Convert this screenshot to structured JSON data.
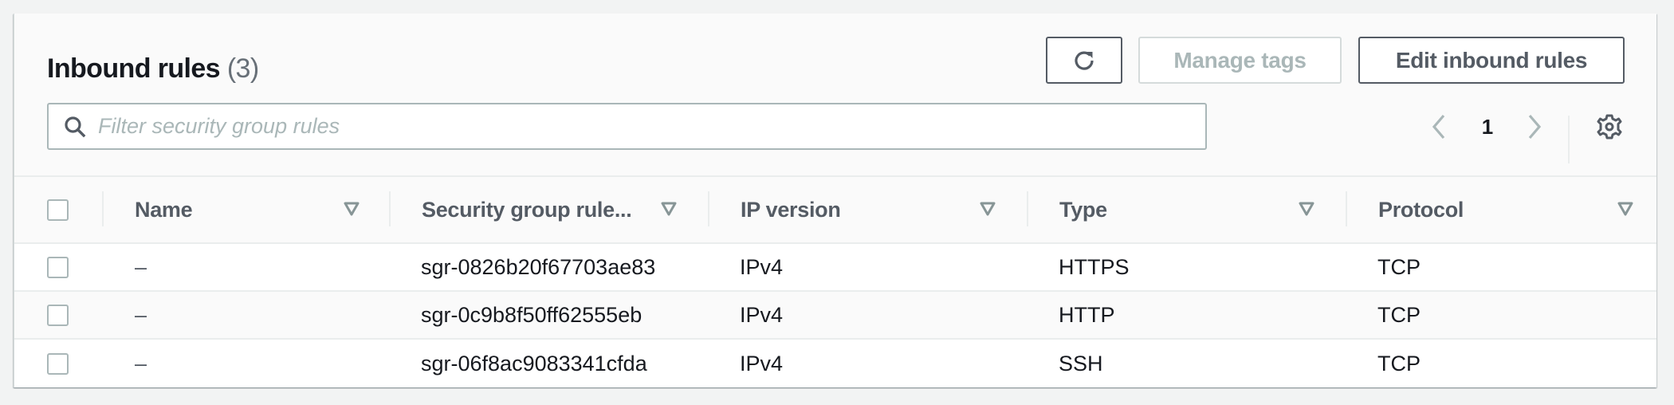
{
  "header": {
    "title": "Inbound rules",
    "count": "(3)"
  },
  "actions": {
    "refresh_icon": "refresh-icon",
    "manage_tags_label": "Manage tags",
    "manage_tags_disabled": true,
    "edit_label": "Edit inbound rules"
  },
  "filter": {
    "placeholder": "Filter security group rules",
    "value": "",
    "icon": "search-icon"
  },
  "pagination": {
    "current_page": "1",
    "prev_icon": "chevron-left-icon",
    "next_icon": "chevron-right-icon",
    "settings_icon": "gear-icon"
  },
  "table": {
    "columns": [
      {
        "label": "Name"
      },
      {
        "label": "Security group rule..."
      },
      {
        "label": "IP version"
      },
      {
        "label": "Type"
      },
      {
        "label": "Protocol"
      }
    ],
    "rows": [
      {
        "name": "–",
        "rule_id": "sgr-0826b20f67703ae83",
        "ip_version": "IPv4",
        "type": "HTTPS",
        "protocol": "TCP"
      },
      {
        "name": "–",
        "rule_id": "sgr-0c9b8f50ff62555eb",
        "ip_version": "IPv4",
        "type": "HTTP",
        "protocol": "TCP"
      },
      {
        "name": "–",
        "rule_id": "sgr-06f8ac9083341cfda",
        "ip_version": "IPv4",
        "type": "SSH",
        "protocol": "TCP"
      }
    ]
  },
  "colors": {
    "text_primary": "#16191f",
    "text_secondary": "#545b64",
    "disabled": "#aab7b8",
    "border": "#eaeded"
  }
}
